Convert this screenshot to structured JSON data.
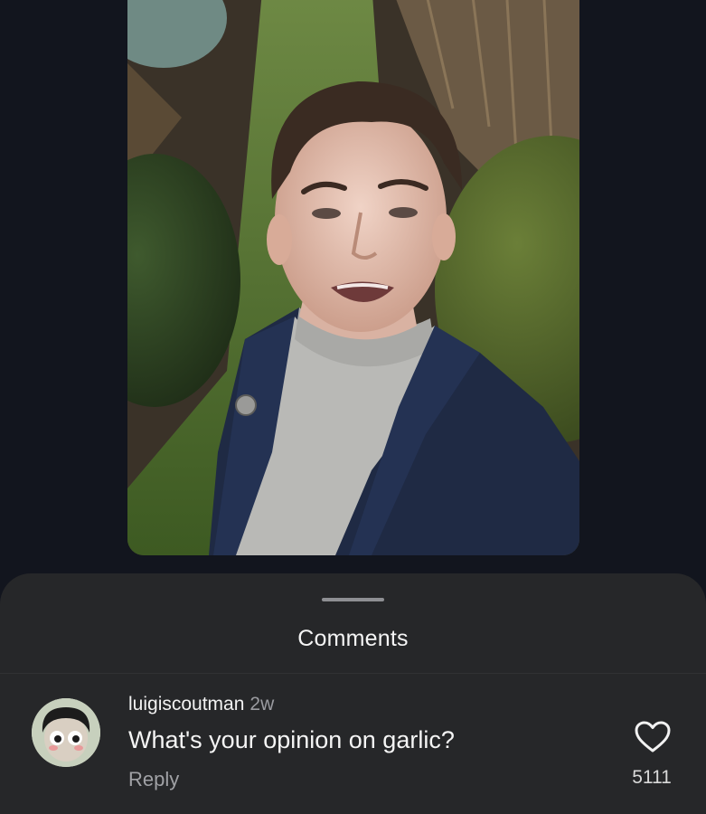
{
  "video": {
    "subject": "person-in-garden"
  },
  "comments_sheet": {
    "title": "Comments",
    "comments": [
      {
        "username": "luigiscoutman",
        "timestamp": "2w",
        "text": "What's your opinion on garlic?",
        "reply_label": "Reply",
        "like_count": "5111",
        "like_icon": "heart-icon"
      }
    ]
  },
  "colors": {
    "background": "#12151e",
    "sheet": "#262729",
    "text": "#f5f5f5",
    "muted_text": "#9a9ba0"
  }
}
